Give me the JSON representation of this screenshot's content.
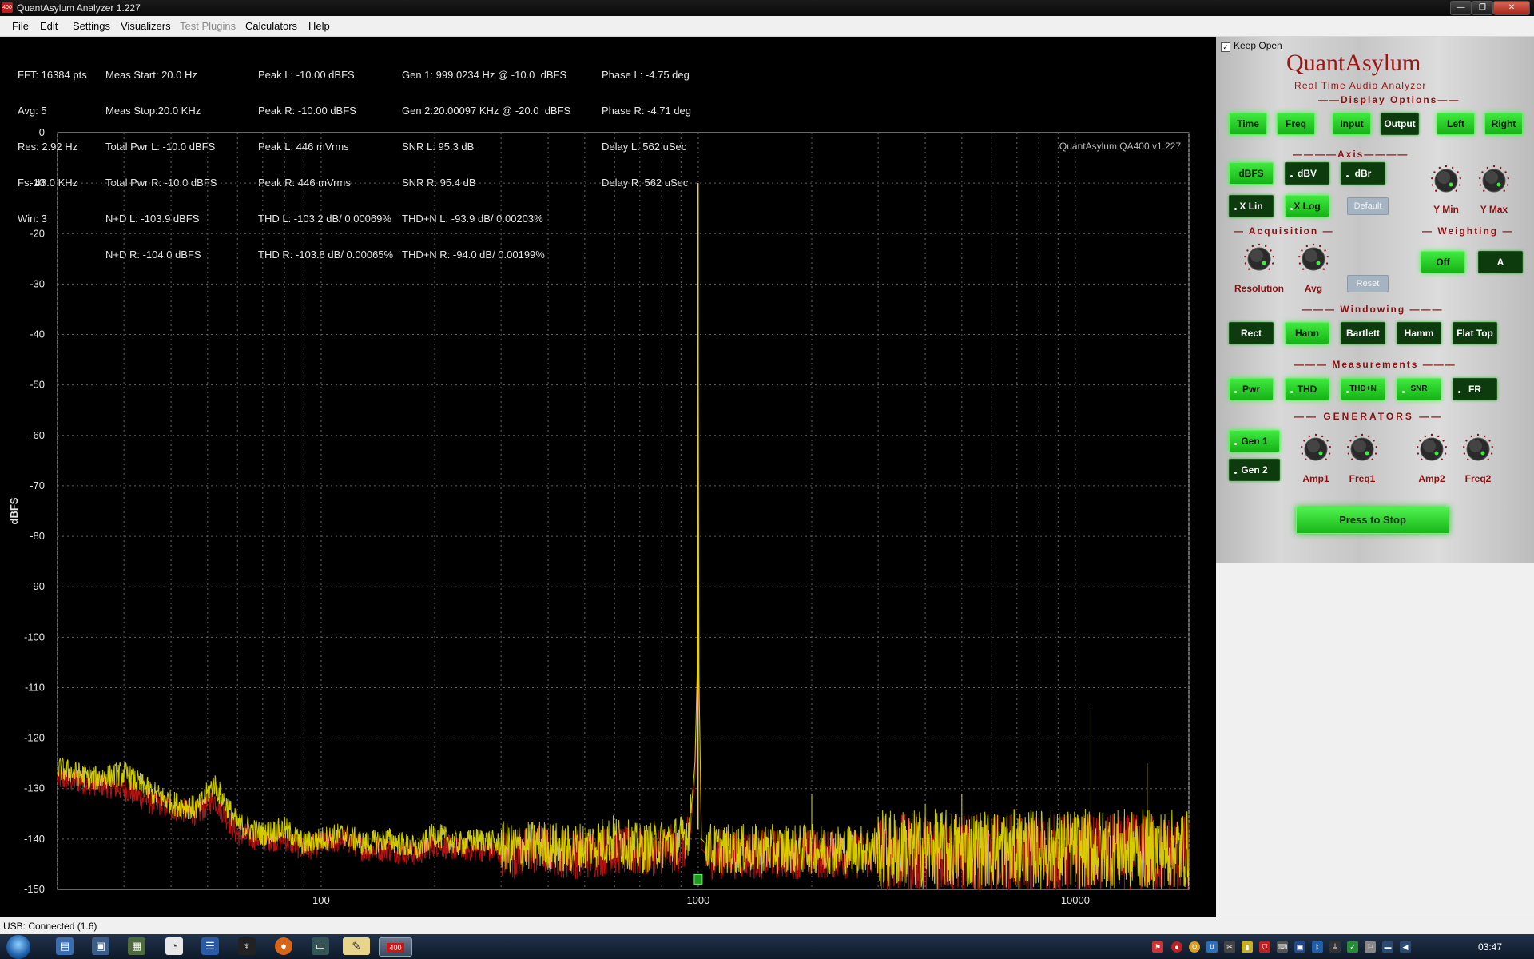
{
  "window": {
    "title": "QuantAsylum Analyzer 1.227",
    "app_icon_text": "400",
    "controls": [
      "—",
      "❐",
      "✕"
    ]
  },
  "menu": [
    {
      "label": "File",
      "enabled": true
    },
    {
      "label": "Edit",
      "enabled": true
    },
    {
      "label": "Settings",
      "enabled": true
    },
    {
      "label": "Visualizers",
      "enabled": true
    },
    {
      "label": "Test Plugins",
      "enabled": false
    },
    {
      "label": "Calculators",
      "enabled": true
    },
    {
      "label": "Help",
      "enabled": true
    }
  ],
  "stats": {
    "col1": [
      "FFT: 16384 pts",
      "Avg: 5",
      "Res: 2.92 Hz",
      "Fs: 48.0 KHz",
      "Win: 3"
    ],
    "col2": [
      "Meas Start: 20.0 Hz",
      "Meas Stop:20.0 KHz",
      "Total Pwr L: -10.0 dBFS",
      "Total Pwr R: -10.0 dBFS",
      "N+D L: -103.9 dBFS",
      "N+D R: -104.0 dBFS"
    ],
    "col3": [
      "Peak L: -10.00 dBFS",
      "Peak R: -10.00 dBFS",
      "Peak L: 446 mVrms",
      "Peak R: 446 mVrms",
      "THD L: -103.2 dB/ 0.00069%",
      "THD R: -103.8 dB/ 0.00065%"
    ],
    "col4_gen1": "Gen 1: 999.0234 Hz @ -10.0  dBFS",
    "col4_gen2": "Gen 2:20.00097 KHz @ -20.0  dBFS",
    "col4": [
      "SNR L: 95.3 dB",
      "SNR R: 95.4 dB",
      "THD+N L: -93.9 dB/ 0.00203%",
      "THD+N R: -94.0 dB/ 0.00199%"
    ],
    "col5": [
      "Phase L: -4.75 deg",
      "Phase R: -4.71 deg",
      "Delay L: 562 uSec",
      "Delay R: 562 uSec"
    ]
  },
  "chart_data": {
    "type": "line",
    "title": "",
    "watermark": "QuantAsylum QA400 v1.227",
    "xlabel": "",
    "ylabel": "dBFS",
    "x_scale": "log",
    "xlim": [
      20,
      20000
    ],
    "ylim": [
      -150,
      0
    ],
    "x_tick_labels": [
      "100",
      "1000",
      "10000"
    ],
    "y_tick_labels": [
      "0",
      "-10",
      "-20",
      "-30",
      "-40",
      "-50",
      "-60",
      "-70",
      "-80",
      "-90",
      "-100",
      "-110",
      "-120",
      "-130",
      "-140",
      "-150"
    ],
    "grid": true,
    "marker": {
      "x": 1000,
      "y": -148
    },
    "colors": {
      "left": "#e0e000",
      "right": "#c81414",
      "background": "#000000",
      "grid": "#606060"
    },
    "series": [
      {
        "channel": "left",
        "x": [
          20,
          25,
          30,
          36,
          41,
          47,
          52,
          60,
          70,
          80,
          90,
          100,
          115,
          130,
          150,
          180,
          200,
          230,
          270,
          320,
          380,
          450,
          520,
          600,
          700,
          800,
          900,
          950,
          980,
          995,
          999,
          1003,
          1020,
          1050,
          1100,
          1300,
          1600,
          2000,
          2500,
          3000,
          4000,
          5000,
          6000,
          8000,
          10000,
          12000,
          15000,
          18000,
          20000
        ],
        "y": [
          -126,
          -128,
          -127,
          -131,
          -133,
          -134,
          -129,
          -137,
          -139,
          -138,
          -141,
          -140,
          -139,
          -141,
          -140,
          -142,
          -139,
          -141,
          -140,
          -142,
          -141,
          -142,
          -141,
          -140,
          -142,
          -141,
          -140,
          -138,
          -125,
          -105,
          -10,
          -105,
          -140,
          -141,
          -142,
          -142,
          -142,
          -142,
          -142,
          -142,
          -142,
          -142,
          -142,
          -142,
          -142,
          -142,
          -142,
          -142,
          -142
        ]
      },
      {
        "channel": "right",
        "x": [
          20,
          25,
          30,
          36,
          41,
          47,
          52,
          60,
          70,
          80,
          90,
          100,
          115,
          130,
          150,
          180,
          200,
          230,
          270,
          320,
          380,
          450,
          520,
          600,
          700,
          800,
          900,
          950,
          980,
          995,
          999,
          1003,
          1020,
          1050,
          1100,
          1300,
          1600,
          2000,
          2500,
          3000,
          4000,
          5000,
          6000,
          8000,
          10000,
          12000,
          15000,
          18000,
          20000
        ],
        "y": [
          -128,
          -129,
          -130,
          -133,
          -134,
          -135,
          -132,
          -139,
          -140,
          -140,
          -142,
          -141,
          -140,
          -142,
          -142,
          -143,
          -141,
          -142,
          -142,
          -143,
          -142,
          -143,
          -143,
          -142,
          -143,
          -142,
          -142,
          -140,
          -128,
          -108,
          -10,
          -108,
          -142,
          -143,
          -143,
          -143,
          -143,
          -143,
          -143,
          -143,
          -143,
          -143,
          -143,
          -143,
          -143,
          -143,
          -143,
          -143,
          -143
        ]
      }
    ],
    "harmonic_spurs": [
      {
        "x": 2000,
        "y": -131
      },
      {
        "x": 3000,
        "y": -137
      },
      {
        "x": 4000,
        "y": -133
      },
      {
        "x": 5000,
        "y": -131
      },
      {
        "x": 6000,
        "y": -136
      },
      {
        "x": 7000,
        "y": -138
      },
      {
        "x": 9000,
        "y": -138
      },
      {
        "x": 11000,
        "y": -114
      },
      {
        "x": 15500,
        "y": -125
      }
    ]
  },
  "panel": {
    "keep_open": "Keep Open",
    "brand": "QuantAsylum",
    "tagline": "Real Time Audio Analyzer",
    "sections": {
      "display": "Display Options",
      "axis": "Axis",
      "acquisition": "Acquisition",
      "weighting": "Weighting",
      "windowing": "Windowing",
      "measurements": "Measurements",
      "generators": "GENERATORS"
    },
    "display_buttons": [
      "Time",
      "Freq",
      "Input",
      "Output",
      "Left",
      "Right"
    ],
    "axis_buttons_row1": [
      "dBFS",
      "dBV",
      "dBr"
    ],
    "axis_buttons_row2": [
      "X Lin",
      "X Log",
      "Default"
    ],
    "axis_knobs": [
      "Y Min",
      "Y Max"
    ],
    "acq_knobs": [
      "Resolution",
      "Avg"
    ],
    "acq_reset": "Reset",
    "weighting_buttons": [
      "Off",
      "A"
    ],
    "window_buttons": [
      "Rect",
      "Hann",
      "Bartlett",
      "Hamm",
      "Flat Top"
    ],
    "measure_buttons": [
      "Pwr",
      "THD",
      "THD+N",
      "SNR",
      "FR"
    ],
    "gen_buttons": [
      "Gen 1",
      "Gen 2"
    ],
    "gen_knobs": [
      "Amp1",
      "Freq1",
      "Amp2",
      "Freq2"
    ],
    "stop_button": "Press to Stop"
  },
  "status": "USB: Connected  (1.6)",
  "taskbar": {
    "clock": "03:47",
    "pinned": [
      "explorer-icon",
      "remote-desktop-icon",
      "monitor-icon",
      "chart-icon",
      "browser-icon",
      "list-icon",
      "sword-icon",
      "firefox-icon",
      "terminal-icon",
      "paint-icon",
      "analyzer-app-icon"
    ],
    "analyzer_label": "400"
  }
}
